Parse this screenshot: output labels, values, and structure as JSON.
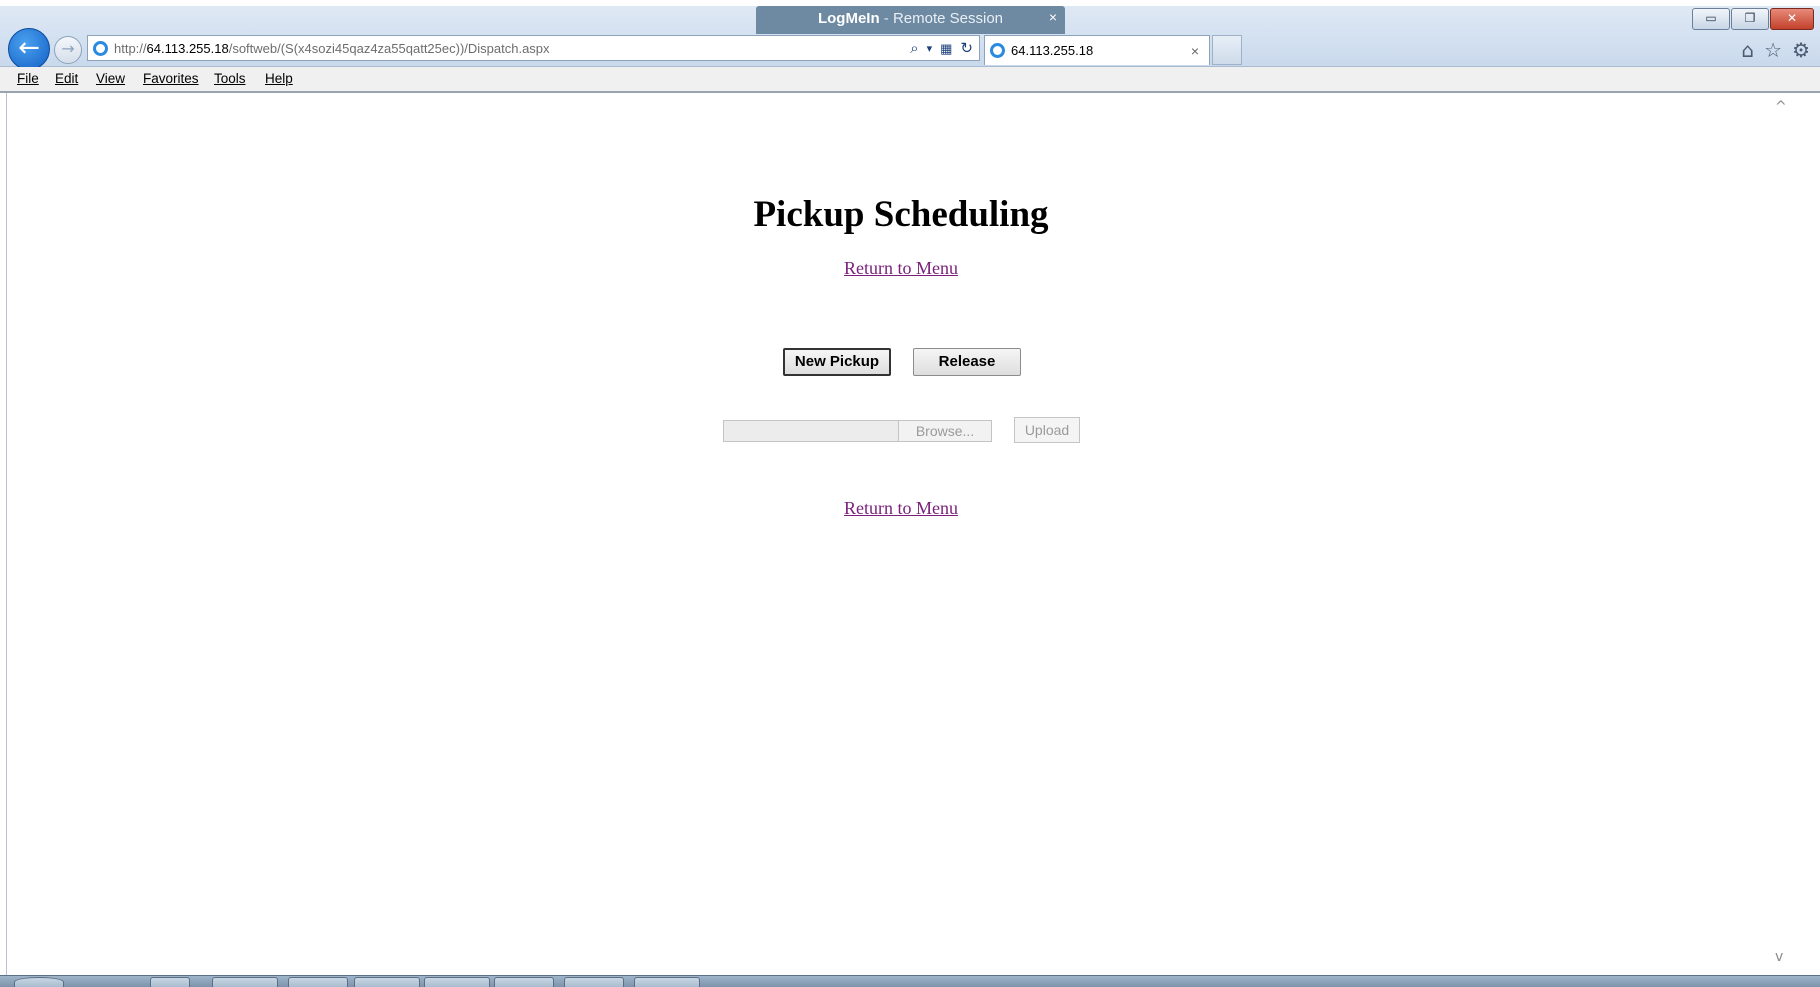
{
  "session": {
    "brand": "LogMeIn",
    "separator": " - ",
    "label": "Remote Session",
    "close": "×"
  },
  "browser": {
    "url_prefix": "http://",
    "url_host": "64.113.255.18",
    "url_path": "/softweb/(S(x4sozi45qaz4za55qatt25ec))/Dispatch.aspx",
    "tab_title": "64.113.255.18",
    "tab_close": "×",
    "window_buttons": {
      "minimize": "▭",
      "restore": "❐",
      "close": "✕"
    },
    "nav": {
      "back": "←",
      "forward": "→"
    },
    "addr_tools": {
      "search": "⌕",
      "dropdown": "▾",
      "compat": "▦",
      "refresh": "↻"
    },
    "right_icons": {
      "home": "⌂",
      "favorites": "☆",
      "settings": "⚙"
    }
  },
  "menu": {
    "items": [
      "File",
      "Edit",
      "View",
      "Favorites",
      "Tools",
      "Help"
    ]
  },
  "page": {
    "title": "Pickup Scheduling",
    "return_link_top": "Return to Menu",
    "new_pickup_label": "New Pickup",
    "release_label": "Release",
    "browse_label": "Browse...",
    "upload_label": "Upload",
    "return_link_bottom": "Return to Menu"
  },
  "scroll": {
    "up": "^",
    "down": "v"
  },
  "colors": {
    "link": "#7a1f7a",
    "session_tab": "#6e8aa3",
    "back_button": "#1260c4"
  }
}
